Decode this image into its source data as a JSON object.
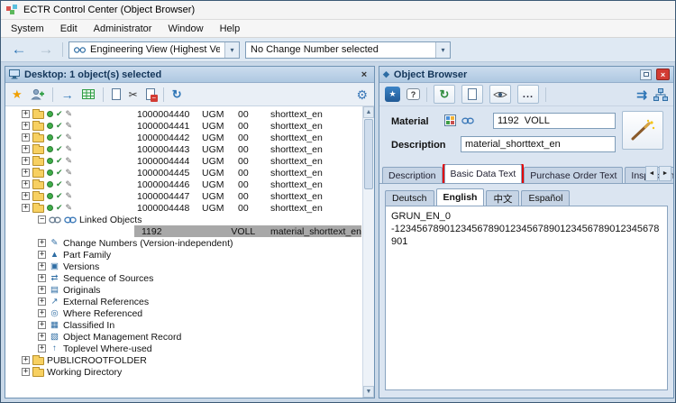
{
  "window": {
    "title": "ECTR Control Center (Object Browser)",
    "menu": [
      "System",
      "Edit",
      "Administrator",
      "Window",
      "Help"
    ]
  },
  "main_toolbar": {
    "view_dropdown": "Engineering View (Highest Version)",
    "change_dropdown": "No Change Number selected"
  },
  "desktop_panel": {
    "title": "Desktop: 1 object(s) selected",
    "material_rows": [
      {
        "id": "1000004440",
        "type": "UGM",
        "version": "00",
        "description": "shorttext_en"
      },
      {
        "id": "1000004441",
        "type": "UGM",
        "version": "00",
        "description": "shorttext_en"
      },
      {
        "id": "1000004442",
        "type": "UGM",
        "version": "00",
        "description": "shorttext_en"
      },
      {
        "id": "1000004443",
        "type": "UGM",
        "version": "00",
        "description": "shorttext_en"
      },
      {
        "id": "1000004444",
        "type": "UGM",
        "version": "00",
        "description": "shorttext_en"
      },
      {
        "id": "1000004445",
        "type": "UGM",
        "version": "00",
        "description": "shorttext_en"
      },
      {
        "id": "1000004446",
        "type": "UGM",
        "version": "00",
        "description": "shorttext_en"
      },
      {
        "id": "1000004447",
        "type": "UGM",
        "version": "00",
        "description": "shorttext_en"
      },
      {
        "id": "1000004448",
        "type": "UGM",
        "version": "00",
        "description": "shorttext_en"
      }
    ],
    "linked_objects": {
      "label": "Linked Objects",
      "selected": {
        "id": "1192",
        "type": "VOLL",
        "description": "material_shorttext_en"
      }
    },
    "category_nodes": [
      {
        "label": "Change Numbers (Version-independent)",
        "glyph": "✎"
      },
      {
        "label": "Part Family",
        "glyph": "▲"
      },
      {
        "label": "Versions",
        "glyph": "▣"
      },
      {
        "label": "Sequence of Sources",
        "glyph": "⇄"
      },
      {
        "label": "Originals",
        "glyph": "▤"
      },
      {
        "label": "External References",
        "glyph": "↗"
      },
      {
        "label": "Where Referenced",
        "glyph": "◎"
      },
      {
        "label": "Classified In",
        "glyph": "▦"
      },
      {
        "label": "Object Management Record",
        "glyph": "▧"
      },
      {
        "label": "Toplevel Where-used",
        "glyph": "↑"
      }
    ],
    "root_nodes": [
      {
        "label": "PUBLICROOTFOLDER"
      },
      {
        "label": "Working Directory"
      }
    ]
  },
  "object_browser": {
    "title": "Object Browser",
    "more_label": "...",
    "form": {
      "material_label": "Material",
      "material_value": "1192  VOLL",
      "description_label": "Description",
      "description_value": "material_shorttext_en"
    },
    "tabs": [
      {
        "label": "Description",
        "active": false
      },
      {
        "label": "Basic Data Text",
        "active": true,
        "highlighted": true
      },
      {
        "label": "Purchase Order Text",
        "active": false
      },
      {
        "label": "Inspection...",
        "active": false
      }
    ],
    "language_tabs": [
      {
        "label": "Deutsch",
        "active": false
      },
      {
        "label": "English",
        "active": true
      },
      {
        "label": "中文",
        "active": false
      },
      {
        "label": "Español",
        "active": false
      }
    ],
    "text_lines": [
      "GRUN_EN_0",
      "-123456789012345678901234567890123456789012345678901"
    ]
  },
  "icons": {
    "back": "←",
    "forward": "→",
    "dropdown": "▾",
    "star": "★",
    "scissors": "✂",
    "gear": "⚙",
    "refresh": "↻",
    "check": "✔",
    "pencil": "✎",
    "double_arrow": "⇉",
    "diamond": "◆",
    "close": "×",
    "help": "?",
    "tab_prev": "◄",
    "tab_next": "►",
    "scroll_up": "▲",
    "scroll_down": "▼",
    "expander_open": "−",
    "expander_closed": "+"
  },
  "colors": {
    "highlight_red": "#e10000",
    "accent_blue": "#2e75b6",
    "selection_gray": "#a8a8a8"
  }
}
